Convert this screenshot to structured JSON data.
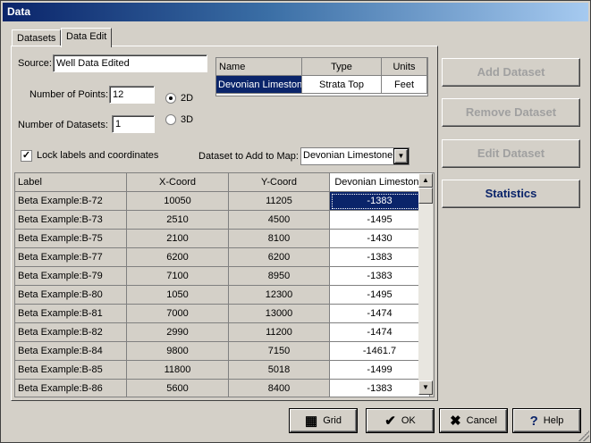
{
  "window": {
    "title": "Data"
  },
  "tabs": [
    {
      "label": "Datasets"
    },
    {
      "label": "Data Edit"
    }
  ],
  "form": {
    "source_label": "Source:",
    "source_value": "Well Data Edited",
    "points_label": "Number of Points:",
    "points_value": "12",
    "datasets_label": "Number of Datasets:",
    "datasets_value": "1",
    "radio_2d": "2D",
    "radio_3d": "3D",
    "lock_label": "Lock labels and coordinates",
    "add_label": "Dataset to Add to Map:",
    "add_value": "Devonian Limestone"
  },
  "dataset_table": {
    "headers": [
      "Name",
      "Type",
      "Units"
    ],
    "row": [
      "Devonian Limeston",
      "Strata Top",
      "Feet"
    ]
  },
  "grid": {
    "headers": [
      "Label",
      "X-Coord",
      "Y-Coord",
      "Devonian Limestone"
    ],
    "rows": [
      [
        "Beta Example:B-72",
        "10050",
        "11205",
        "-1383"
      ],
      [
        "Beta Example:B-73",
        "2510",
        "4500",
        "-1495"
      ],
      [
        "Beta Example:B-75",
        "2100",
        "8100",
        "-1430"
      ],
      [
        "Beta Example:B-77",
        "6200",
        "6200",
        "-1383"
      ],
      [
        "Beta Example:B-79",
        "7100",
        "8950",
        "-1383"
      ],
      [
        "Beta Example:B-80",
        "1050",
        "12300",
        "-1495"
      ],
      [
        "Beta Example:B-81",
        "7000",
        "13000",
        "-1474"
      ],
      [
        "Beta Example:B-82",
        "2990",
        "11200",
        "-1474"
      ],
      [
        "Beta Example:B-84",
        "9800",
        "7150",
        "-1461.7"
      ],
      [
        "Beta Example:B-85",
        "11800",
        "5018",
        "-1499"
      ],
      [
        "Beta Example:B-86",
        "5600",
        "8400",
        "-1383"
      ]
    ]
  },
  "side_buttons": {
    "add": "Add Dataset",
    "remove": "Remove Dataset",
    "edit": "Edit Dataset",
    "stats": "Statistics"
  },
  "footer": {
    "grid": "Grid",
    "ok": "OK",
    "cancel": "Cancel",
    "help": "Help"
  }
}
